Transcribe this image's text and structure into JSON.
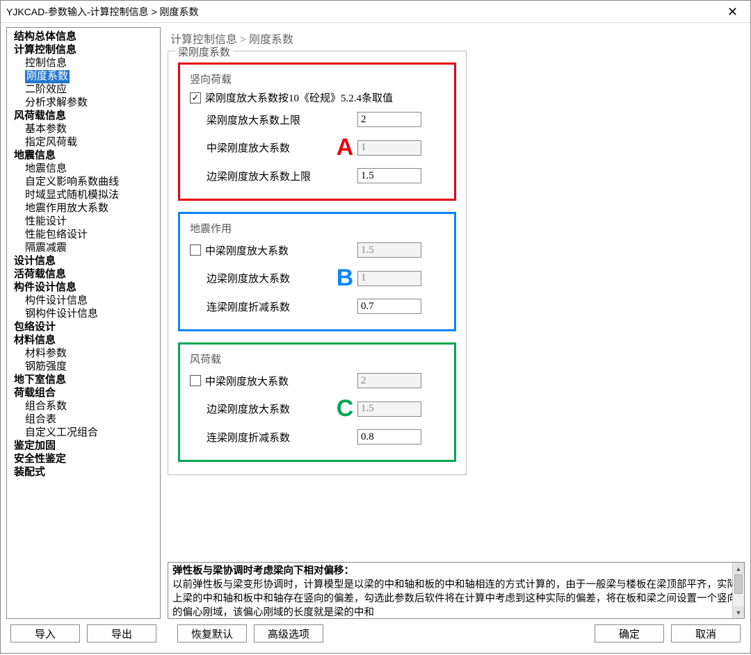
{
  "title": "YJKCAD-参数输入-计算控制信息 > 刚度系数",
  "breadcrumb": "计算控制信息 > 刚度系数",
  "group_title": "梁刚度系数",
  "tree": {
    "n0": "结构总体信息",
    "n1": "计算控制信息",
    "n1a": "控制信息",
    "n1b": "刚度系数",
    "n1c": "二阶效应",
    "n1d": "分析求解参数",
    "n2": "风荷载信息",
    "n2a": "基本参数",
    "n2b": "指定风荷载",
    "n3": "地震信息",
    "n3a": "地震信息",
    "n3b": "自定义影响系数曲线",
    "n3c": "时域显式随机模拟法",
    "n3d": "地震作用放大系数",
    "n3e": "性能设计",
    "n3f": "性能包络设计",
    "n3g": "隔震减震",
    "n4": "设计信息",
    "n5": "活荷载信息",
    "n6": "构件设计信息",
    "n6a": "构件设计信息",
    "n6b": "钢构件设计信息",
    "n7": "包络设计",
    "n8": "材料信息",
    "n8a": "材料参数",
    "n8b": "钢筋强度",
    "n9": "地下室信息",
    "n10": "荷载组合",
    "n10a": "组合系数",
    "n10b": "组合表",
    "n10c": "自定义工况组合",
    "n11": "鉴定加固",
    "n12": "安全性鉴定",
    "n13": "装配式"
  },
  "sectionA": {
    "title": "竖向荷载",
    "chk_label": "梁刚度放大系数按10《砼规》5.2.4条取值",
    "chk_checked": true,
    "r1_label": "梁刚度放大系数上限",
    "r1_val": "2",
    "r2_label": "中梁刚度放大系数",
    "r2_val": "1",
    "r3_label": "边梁刚度放大系数上限",
    "r3_val": "1.5",
    "letter": "A"
  },
  "sectionB": {
    "title": "地震作用",
    "chk_label": "中梁刚度放大系数",
    "chk_checked": false,
    "r1_val": "1.5",
    "r2_label": "边梁刚度放大系数",
    "r2_val": "1",
    "r3_label": "连梁刚度折减系数",
    "r3_val": "0.7",
    "letter": "B"
  },
  "sectionC": {
    "title": "风荷载",
    "chk_label": "中梁刚度放大系数",
    "chk_checked": false,
    "r1_val": "2",
    "r2_label": "边梁刚度放大系数",
    "r2_val": "1.5",
    "r3_label": "连梁刚度折减系数",
    "r3_val": "0.8",
    "letter": "C"
  },
  "desc": {
    "title": "弹性板与梁协调时考虑梁向下相对偏移：",
    "body": "以前弹性板与梁变形协调时，计算模型是以梁的中和轴和板的中和轴相连的方式计算的，由于一般梁与楼板在梁顶部平齐，实际上梁的中和轴和板中和轴存在竖向的偏差，勾选此参数后软件将在计算中考虑到这种实际的偏差，将在板和梁之间设置一个竖向的偏心刚域，该偏心刚域的长度就是梁的中和"
  },
  "buttons": {
    "import": "导入",
    "export": "导出",
    "reset": "恢复默认",
    "adv": "高级选项",
    "ok": "确定",
    "cancel": "取消"
  }
}
